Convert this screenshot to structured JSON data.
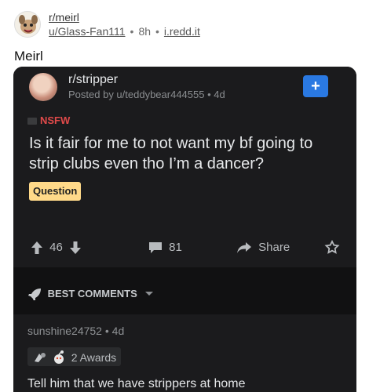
{
  "outer": {
    "subreddit": "r/meirl",
    "user": "u/Glass-Fan111",
    "age": "8h",
    "domain": "i.redd.it",
    "title": "Meirl"
  },
  "shot": {
    "subreddit": "r/stripper",
    "meta": "Posted by u/teddybear444555 • 4d",
    "plus": "+",
    "nsfw": "NSFW",
    "title": "Is it fair for me to not want my bf going to strip clubs even tho I’m a dancer?",
    "flair": "Question",
    "upvotes": "46",
    "comments": "81",
    "share": "Share",
    "best_comments": "BEST COMMENTS",
    "comment": {
      "user": "sunshine24752 • 4d",
      "awards": "2 Awards",
      "text": "Tell him that we have strippers at home"
    }
  },
  "colors": {
    "card_bg": "#1b1b1d",
    "plus_btn": "#2a79e2",
    "nsfw": "#e04a4a",
    "flair_bg": "#ffd989"
  },
  "icons": [
    "snoo-avatar-icon",
    "upvote-arrow-icon",
    "downvote-arrow-icon",
    "comment-bubble-icon",
    "share-arrow-icon",
    "award-icon",
    "rocket-icon",
    "chevron-down-icon"
  ]
}
